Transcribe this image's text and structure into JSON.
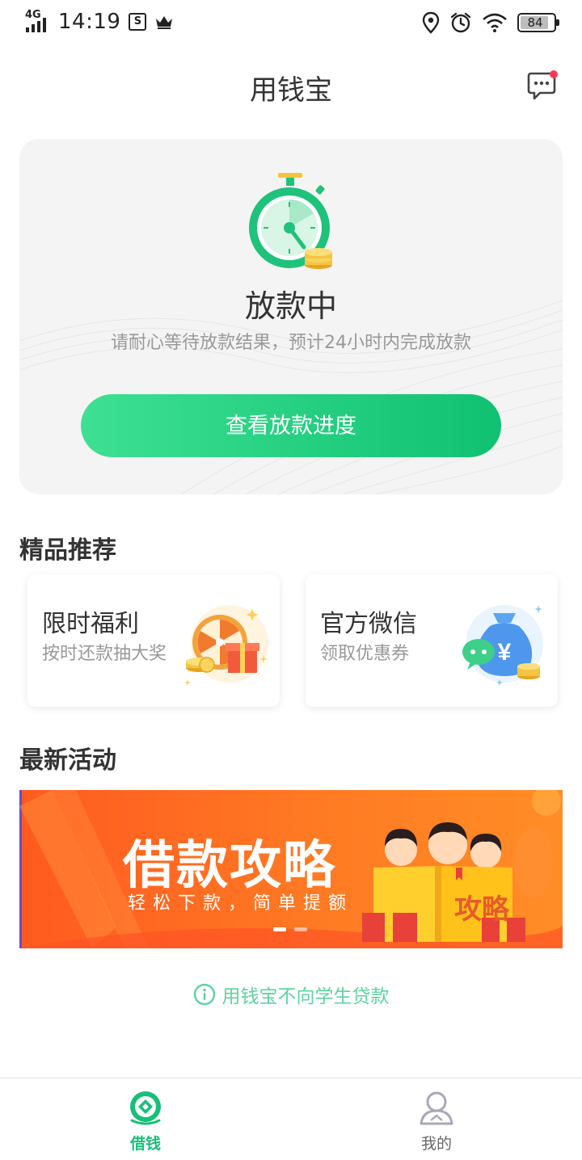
{
  "status_bar": {
    "network": "4G",
    "time": "14:19",
    "battery": "84",
    "icons": [
      "signal-icon",
      "s-app-icon",
      "crown-icon",
      "location-icon",
      "alarm-icon",
      "wifi-icon",
      "battery-icon"
    ]
  },
  "header": {
    "title": "用钱宝",
    "message_icon": "chat-bubble-icon"
  },
  "status_card": {
    "title": "放款中",
    "description": "请耐心等待放款结果，预计24小时内完成放款",
    "button_label": "查看放款进度"
  },
  "recommend": {
    "section_title": "精品推荐",
    "cards": [
      {
        "title": "限时福利",
        "subtitle": "按时还款抽大奖",
        "icon": "prize-wheel-icon"
      },
      {
        "title": "官方微信",
        "subtitle": "领取优惠券",
        "icon": "wechat-money-bag-icon"
      }
    ]
  },
  "activities": {
    "section_title": "最新活动",
    "banner": {
      "title": "借款攻略",
      "subtitle": "轻松下款，简单提额",
      "book_text": "攻略"
    }
  },
  "notice": {
    "text": "用钱宝不向学生贷款"
  },
  "tab_bar": {
    "tabs": [
      {
        "label": "借钱",
        "active": true
      },
      {
        "label": "我的",
        "active": false
      }
    ]
  },
  "colors": {
    "accent": "#18bf78",
    "button_start": "#3ee092",
    "button_end": "#10c172",
    "banner": "#ff6a22",
    "notice": "#5fd3a0"
  }
}
